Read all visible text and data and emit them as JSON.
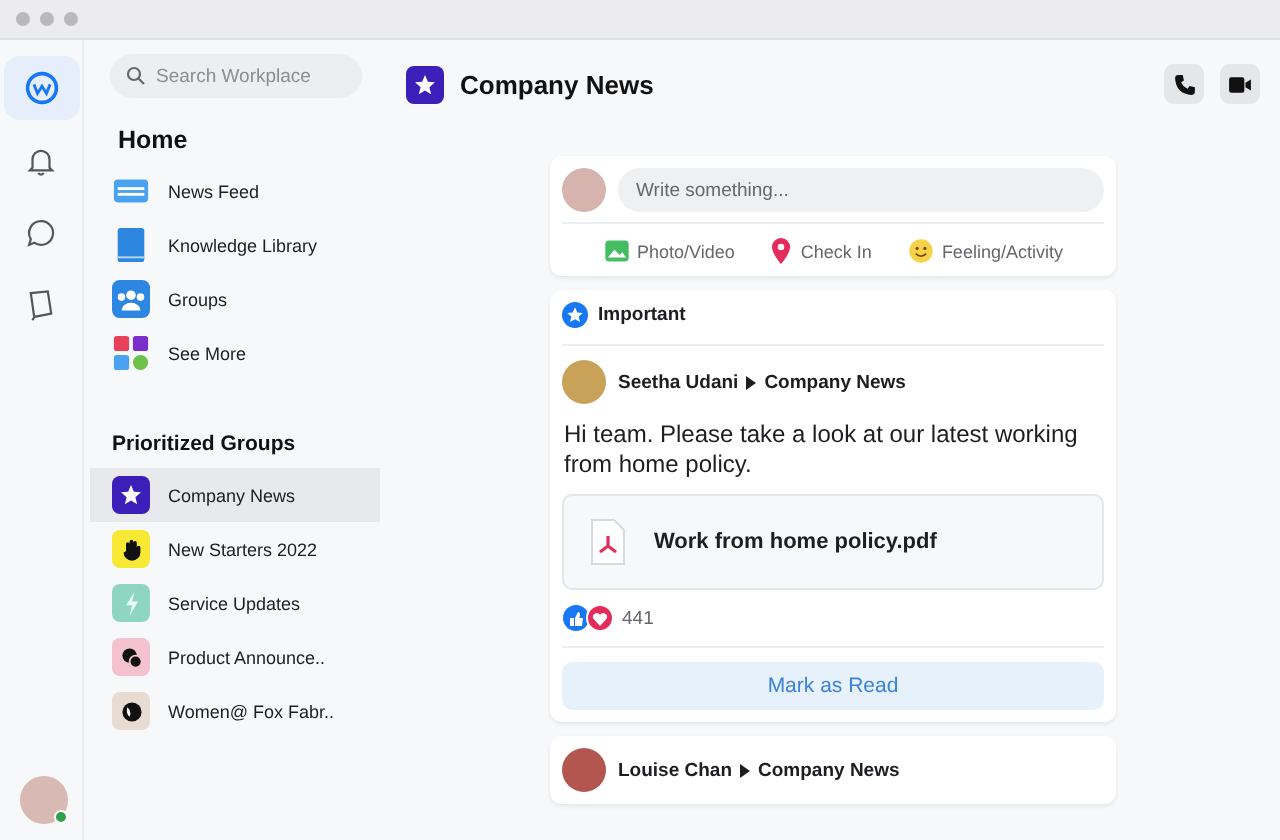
{
  "rail": [
    {
      "kind": "workplace",
      "selected": true
    },
    {
      "kind": "bell",
      "selected": false
    },
    {
      "kind": "chat",
      "selected": false
    },
    {
      "kind": "book",
      "selected": false
    }
  ],
  "sidebar": {
    "search": {
      "placeholder": "Search Workplace"
    },
    "home_title": "Home",
    "home_items": [
      {
        "label": "News Feed",
        "kind": "feed"
      },
      {
        "label": "Knowledge Library",
        "kind": "library"
      },
      {
        "label": "Groups",
        "kind": "groups"
      },
      {
        "label": "See More",
        "kind": "more"
      }
    ],
    "groups_title": "Prioritized Groups",
    "groups": [
      {
        "label": "Company News",
        "selected": true,
        "color": "#3b1fb8",
        "kind": "star"
      },
      {
        "label": "New Starters 2022",
        "selected": false,
        "color": "#f7e833",
        "kind": "hand"
      },
      {
        "label": "Service Updates",
        "selected": false,
        "color": "#8ed6c0",
        "kind": "bolt"
      },
      {
        "label": "Product Announce..",
        "selected": false,
        "color": "#f4c2cf",
        "kind": "chat"
      },
      {
        "label": "Women@ Fox Fabr..",
        "selected": false,
        "color": "#e8dcd2",
        "kind": "globe"
      }
    ]
  },
  "header": {
    "title": "Company News"
  },
  "composer": {
    "placeholder": "Write something...",
    "actions": [
      {
        "label": "Photo/Video",
        "kind": "photo"
      },
      {
        "label": "Check In",
        "kind": "pin"
      },
      {
        "label": "Feeling/Activity",
        "kind": "smile"
      }
    ]
  },
  "posts": [
    {
      "badge": "Important",
      "author": "Seetha Udani",
      "group": "Company News",
      "text": "Hi team. Please take a look at our latest working from home policy.",
      "attachment": "Work from home policy.pdf",
      "reactions": "441",
      "button": "Mark as Read"
    },
    {
      "author": "Louise Chan",
      "group": "Company News"
    }
  ]
}
